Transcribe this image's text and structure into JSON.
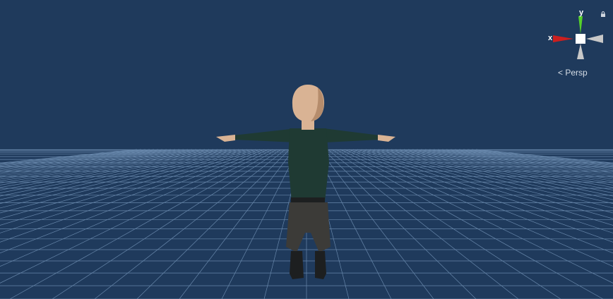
{
  "viewport": {
    "background": "#1f3a5c",
    "grid_color": "#7fa0c4"
  },
  "gizmo": {
    "x_label": "x",
    "y_label": "y",
    "projection_label": "Persp",
    "x_color": "#cc1f1f",
    "y_color": "#56d12a",
    "neutral_color": "#c8c8c8",
    "icons": [
      "lock-icon",
      "perspective-icon"
    ]
  },
  "character": {
    "skin": "#d9b394",
    "shirt": "#1f3a33",
    "pants": "#3c3b38",
    "boots": "#1d1f20"
  }
}
